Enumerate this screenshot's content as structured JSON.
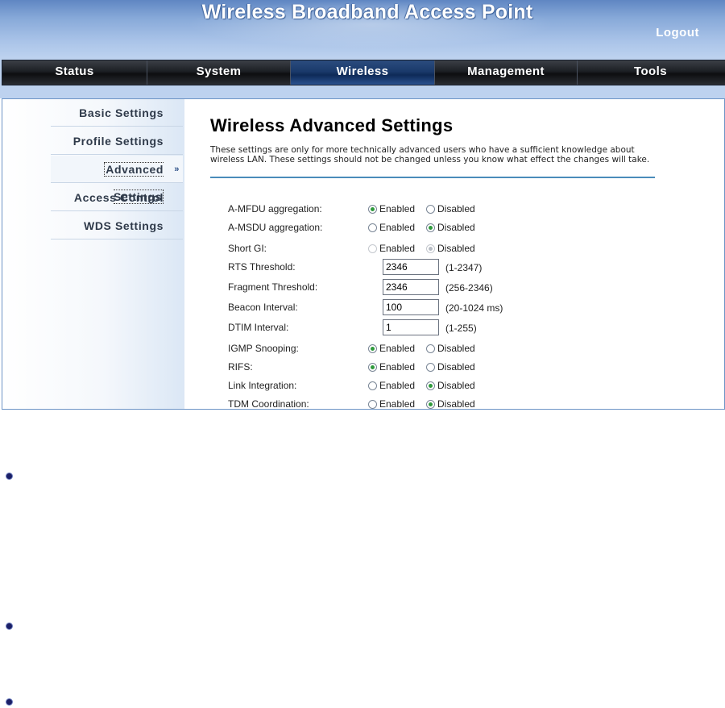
{
  "app": {
    "title": "Wireless Broadband Access Point",
    "logout": "Logout"
  },
  "nav": {
    "tabs": [
      {
        "label": "Status"
      },
      {
        "label": "System"
      },
      {
        "label": "Wireless"
      },
      {
        "label": "Management"
      },
      {
        "label": "Tools"
      }
    ],
    "active": "Wireless"
  },
  "sidebar": {
    "items": [
      {
        "label": "Basic Settings"
      },
      {
        "label": "Profile Settings"
      },
      {
        "label": "Advanced Settings"
      },
      {
        "label": "Access Control"
      },
      {
        "label": "WDS Settings"
      }
    ],
    "active": "Advanced Settings",
    "active_arrow": "»"
  },
  "page": {
    "title": "Wireless Advanced Settings",
    "description": "These settings are only for more technically advanced users who have a sufficient knowledge about wireless LAN. These settings should not be changed unless you know what effect the changes will take."
  },
  "radio_labels": {
    "enabled": "Enabled",
    "disabled": "Disabled"
  },
  "settings": [
    {
      "label": "A-MFDU aggregation:",
      "type": "radio",
      "value": "Enabled"
    },
    {
      "label": "A-MSDU aggregation:",
      "type": "radio",
      "value": "Disabled"
    },
    {
      "label": "Short GI:",
      "type": "radio",
      "value": "Disabled",
      "disabled": true
    },
    {
      "label": "RTS Threshold:",
      "type": "text",
      "value": "2346",
      "range": "(1-2347)"
    },
    {
      "label": "Fragment Threshold:",
      "type": "text",
      "value": "2346",
      "range": "(256-2346)"
    },
    {
      "label": "Beacon Interval:",
      "type": "text",
      "value": "100",
      "range": "(20-1024 ms)"
    },
    {
      "label": "DTIM Interval:",
      "type": "text",
      "value": "1",
      "range": "(1-255)"
    },
    {
      "label": "IGMP Snooping:",
      "type": "radio",
      "value": "Enabled"
    },
    {
      "label": "RIFS:",
      "type": "radio",
      "value": "Enabled"
    },
    {
      "label": "Link Integration:",
      "type": "radio",
      "value": "Disabled"
    },
    {
      "label": "TDM Coordination:",
      "type": "radio",
      "value": "Disabled"
    }
  ],
  "colors": {
    "header": "#86a8d8",
    "nav_active": "#1a3a6b",
    "rule": "#4a8cba",
    "radio_on": "#2f9a3c",
    "bullet": "#1b1f66"
  }
}
